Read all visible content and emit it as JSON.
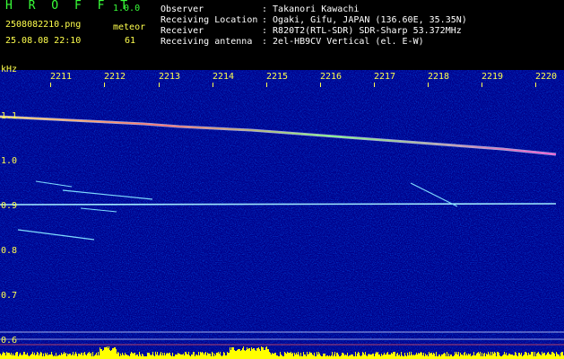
{
  "header": {
    "app_title": "H R O F F T",
    "version": "1.0.0",
    "filename": "2508082210.png",
    "mode": "meteor",
    "datetime": "25.08.08 22:10",
    "count": "61",
    "info": [
      {
        "label": "Observer",
        "value": ": Takanori Kawachi"
      },
      {
        "label": "Receiving Location",
        "value": ": Ogaki, Gifu, JAPAN (136.60E, 35.35N)"
      },
      {
        "label": "Receiver",
        "value": ": R820T2(RTL-SDR) SDR-Sharp 53.372MHz"
      },
      {
        "label": "Receiving antenna",
        "value": ": 2el-HB9CV Vertical (el. E-W)"
      }
    ]
  },
  "axes": {
    "y_unit": "kHz",
    "y_ticks": [
      "1.1",
      "1.0",
      "0.9",
      "0.8",
      "0.7",
      "0.6"
    ],
    "x_ticks": [
      "2211",
      "2212",
      "2213",
      "2214",
      "2215",
      "2216",
      "2217",
      "2218",
      "2219",
      "2220"
    ]
  },
  "colors": {
    "background": "#000000",
    "spectrum_bg": "#00008a",
    "text_yellow": "#ffff4d",
    "text_white": "#ffffff",
    "title_green": "#39ff39",
    "carrier_line": "#9fe9ff",
    "meteor_trace": "#7fdcff",
    "activity_bar": "#ffff00"
  }
}
